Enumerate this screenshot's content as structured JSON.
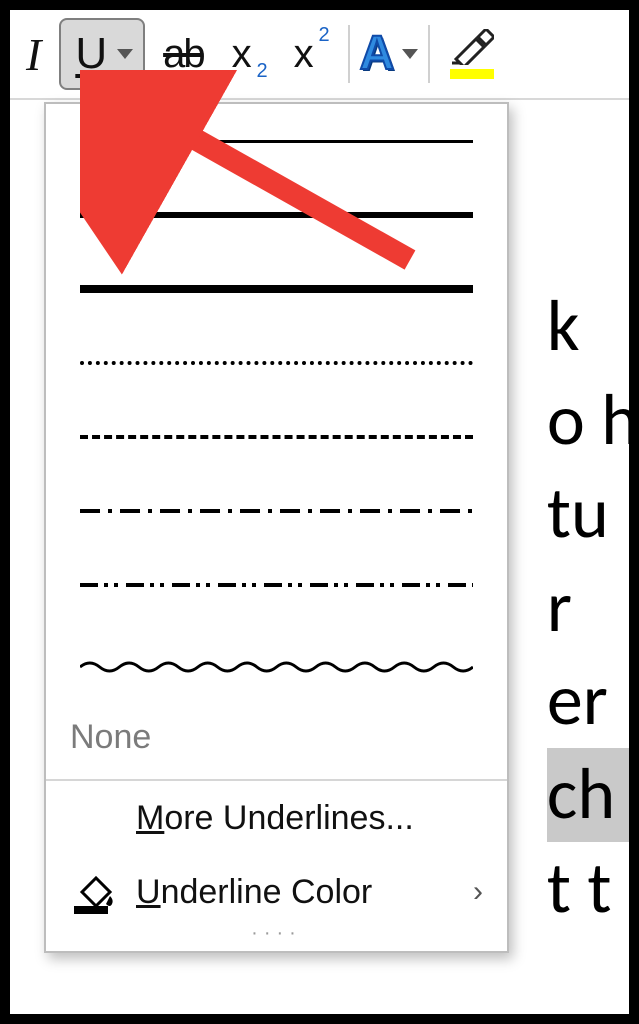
{
  "toolbar": {
    "italic_glyph": "I",
    "underline_glyph": "U",
    "strike_glyph": "ab",
    "subscript_glyph": "x",
    "superscript_glyph": "x",
    "fonteffects_glyph": "A"
  },
  "underline_menu": {
    "styles": [
      "single",
      "double",
      "thick",
      "dotted",
      "dashed",
      "dash-dot",
      "dash-dot-dot",
      "wave"
    ],
    "none_label": "None",
    "more_label_pre": "M",
    "more_label_rest": "ore Underlines...",
    "color_label_pre": "U",
    "color_label_rest": "nderline Color"
  },
  "doc_fragments": [
    "k",
    "o h",
    "tu",
    "r",
    "er",
    "ch",
    "t t"
  ],
  "icons": {
    "caret": "chevron-down-icon",
    "bucket": "paint-bucket-icon",
    "pen": "highlighter-icon",
    "chevron_right": "›"
  }
}
